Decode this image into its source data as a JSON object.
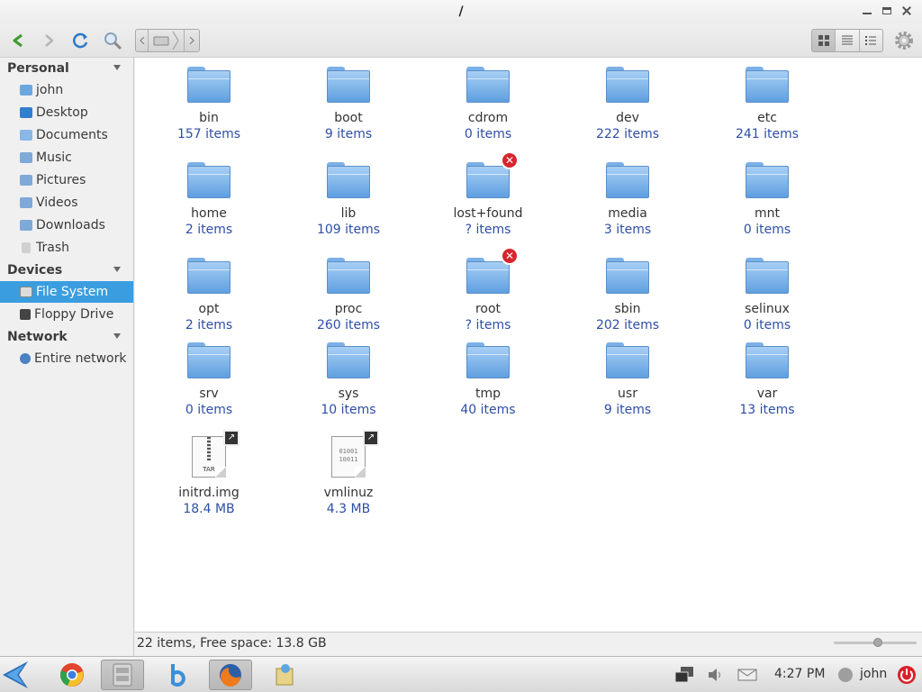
{
  "window": {
    "title": "/"
  },
  "sidebar": {
    "sections": [
      {
        "title": "Personal",
        "items": [
          "john",
          "Desktop",
          "Documents",
          "Music",
          "Pictures",
          "Videos",
          "Downloads",
          "Trash"
        ]
      },
      {
        "title": "Devices",
        "items": [
          "File System",
          "Floppy Drive"
        ]
      },
      {
        "title": "Network",
        "items": [
          "Entire network"
        ]
      }
    ],
    "selected": "File System"
  },
  "items": [
    {
      "name": "bin",
      "count": "157 items",
      "type": "folder"
    },
    {
      "name": "boot",
      "count": "9 items",
      "type": "folder"
    },
    {
      "name": "cdrom",
      "count": "0 items",
      "type": "folder"
    },
    {
      "name": "dev",
      "count": "222 items",
      "type": "folder"
    },
    {
      "name": "etc",
      "count": "241 items",
      "type": "folder"
    },
    {
      "name": "home",
      "count": "2 items",
      "type": "folder"
    },
    {
      "name": "lib",
      "count": "109 items",
      "type": "folder"
    },
    {
      "name": "lost+found",
      "count": "? items",
      "type": "folder-locked"
    },
    {
      "name": "media",
      "count": "3 items",
      "type": "folder"
    },
    {
      "name": "mnt",
      "count": "0 items",
      "type": "folder"
    },
    {
      "name": "opt",
      "count": "2 items",
      "type": "folder"
    },
    {
      "name": "proc",
      "count": "260 items",
      "type": "folder"
    },
    {
      "name": "root",
      "count": "? items",
      "type": "folder-locked"
    },
    {
      "name": "sbin",
      "count": "202 items",
      "type": "folder"
    },
    {
      "name": "selinux",
      "count": "0 items",
      "type": "folder"
    },
    {
      "name": "srv",
      "count": "0 items",
      "type": "folder"
    },
    {
      "name": "sys",
      "count": "10 items",
      "type": "folder"
    },
    {
      "name": "tmp",
      "count": "40 items",
      "type": "folder"
    },
    {
      "name": "usr",
      "count": "9 items",
      "type": "folder"
    },
    {
      "name": "var",
      "count": "13 items",
      "type": "folder"
    },
    {
      "name": "initrd.img",
      "count": "18.4 MB",
      "type": "tar-link",
      "file_label": "TAR"
    },
    {
      "name": "vmlinuz",
      "count": "4.3 MB",
      "type": "binary-link",
      "file_label": "01001 10011"
    }
  ],
  "statusbar": {
    "text": "22 items, Free space: 13.8 GB"
  },
  "taskbar": {
    "clock": "4:27 PM",
    "user": "john"
  },
  "colors": {
    "selection": "#3a9de0",
    "count_text": "#2e4ea8",
    "folder": "#7bb0e6"
  }
}
